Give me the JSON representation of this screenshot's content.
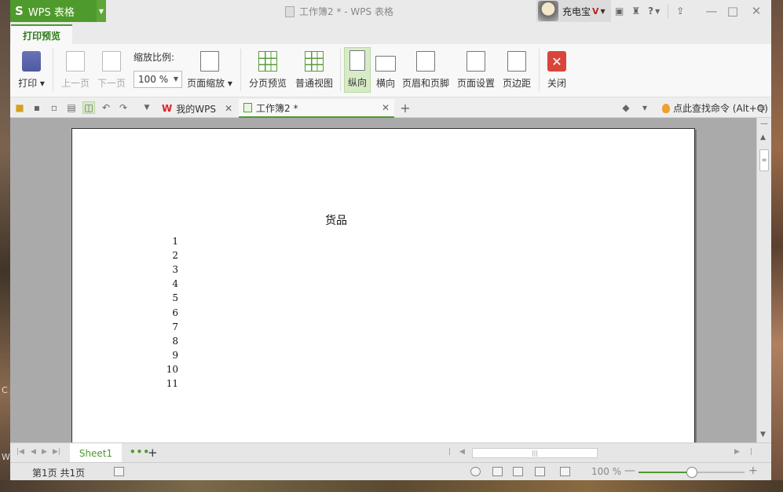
{
  "app": {
    "name": "WPS 表格",
    "logo": "S",
    "window_title": "工作簿2 * - WPS 表格",
    "user_name": "充电宝",
    "vip_badge": "V"
  },
  "ribbon": {
    "active_tab": "打印预览",
    "buttons": {
      "print": "打印",
      "prev_page": "上一页",
      "next_page": "下一页",
      "page_zoom": "页面缩放",
      "page_break_preview": "分页预览",
      "normal_view": "普通视图",
      "portrait": "纵向",
      "landscape": "横向",
      "header_footer": "页眉和页脚",
      "page_setup": "页面设置",
      "margins": "页边距",
      "close": "关闭"
    },
    "zoom_label": "缩放比例:",
    "zoom_value": "100 %"
  },
  "doc_tabs": [
    {
      "label": "我的WPS"
    },
    {
      "label": "工作簿2 *"
    }
  ],
  "find_command": "点此查找命令 (Alt+Q)",
  "preview": {
    "title": "货品",
    "rows": [
      "1",
      "2",
      "3",
      "4",
      "5",
      "6",
      "7",
      "8",
      "9",
      "10",
      "11"
    ]
  },
  "sheet_tab": "Sheet1",
  "status": {
    "page_info": "第1页 共1页",
    "zoom": "100 %",
    "zoom_fraction": 0.5
  },
  "desktop_stubs": [
    "C",
    "W"
  ],
  "colors": {
    "brand_green": "#4e9a2c",
    "close_red": "#d9453a"
  }
}
